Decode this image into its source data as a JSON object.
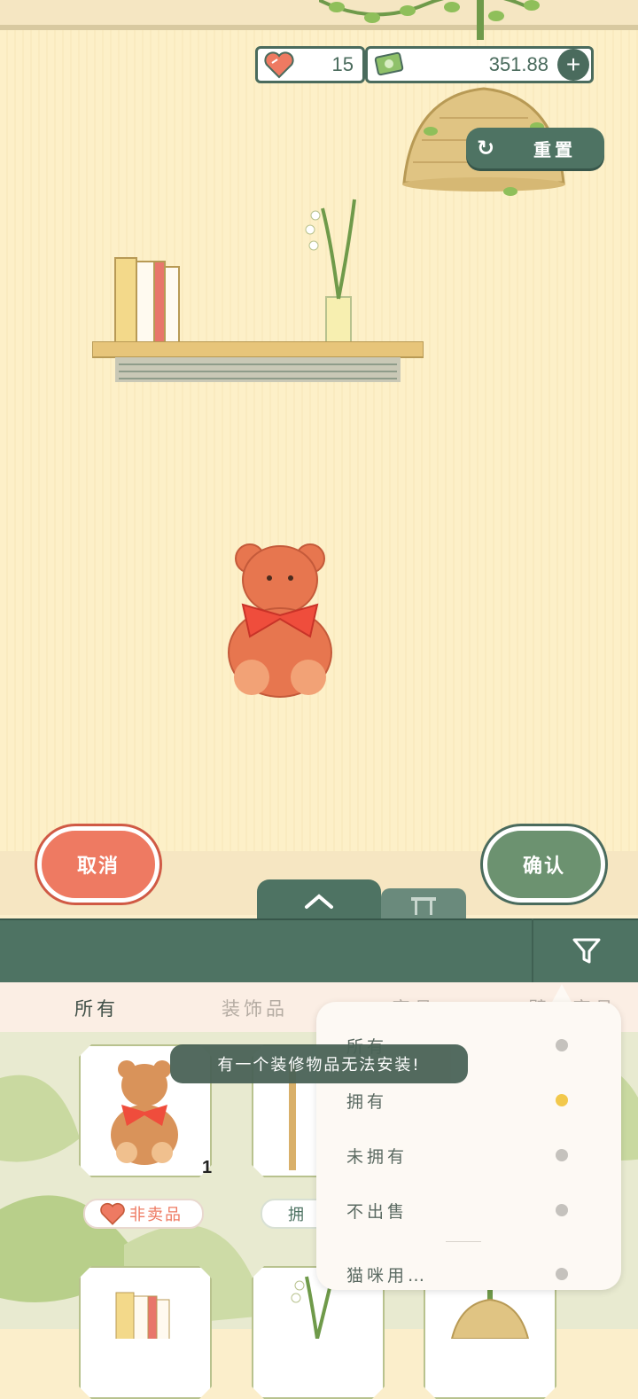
{
  "header": {
    "hearts": "15",
    "money": "351.88",
    "plus_label": "+",
    "reset_label": "重置",
    "reset_icon": "refresh-icon"
  },
  "actions": {
    "cancel_label": "取消",
    "confirm_label": "确认"
  },
  "bottom_tabs": {
    "expand_icon": "chevron-up-icon",
    "furniture_icon": "table-icon",
    "filter_icon": "funnel-icon"
  },
  "categories": [
    {
      "label": "所有",
      "active": true
    },
    {
      "label": "装饰品",
      "active": false
    },
    {
      "label": "家具",
      "active": false
    },
    {
      "label": "壁…家具",
      "active": false
    }
  ],
  "items": [
    {
      "name": "teddy-bear",
      "count": "1",
      "tag": "非卖品"
    },
    {
      "name": "easel",
      "tag": "拥"
    }
  ],
  "toast": "有一个装修物品无法安装!",
  "filter_menu": [
    {
      "label": "所有",
      "selected": false
    },
    {
      "label": "拥有",
      "selected": true
    },
    {
      "label": "未拥有",
      "selected": false
    },
    {
      "label": "不出售",
      "selected": false
    },
    {
      "label": "猫咪用…",
      "selected": false
    }
  ],
  "colors": {
    "primary_green": "#4e7363",
    "cancel_red": "#ee7a62",
    "confirm_green": "#6c9270",
    "selected_dot": "#f2c84b"
  }
}
